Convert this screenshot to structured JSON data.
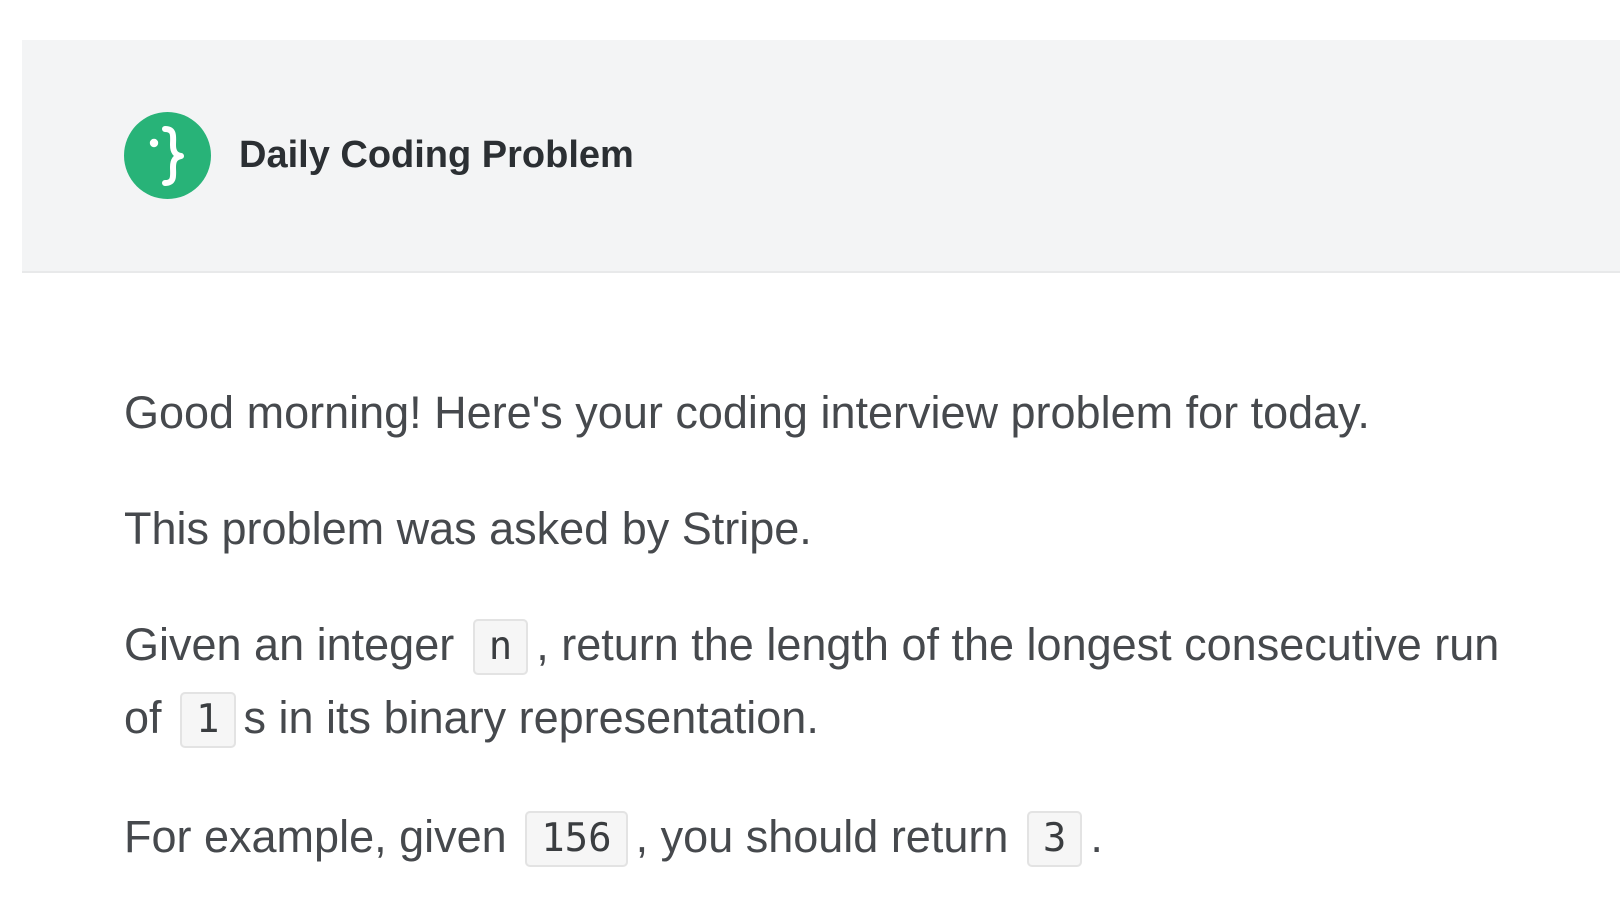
{
  "header": {
    "brand_name": "Daily Coding Problem",
    "logo_icon": "curly-brace-logo-icon",
    "logo_color": "#28b378"
  },
  "email": {
    "greeting": "Good morning! Here's your coding interview problem for today.",
    "company_line": "This problem was asked by Stripe.",
    "problem": {
      "part1": "Given an integer",
      "code_n": "n",
      "part2": ", return the length of the longest consecutive run",
      "part3": "of",
      "code_one": "1",
      "part4": "s in its binary representation."
    },
    "example": {
      "part1": "For example, given",
      "code_input": "156",
      "part2": ", you should return",
      "code_output": "3",
      "part3": "."
    }
  }
}
